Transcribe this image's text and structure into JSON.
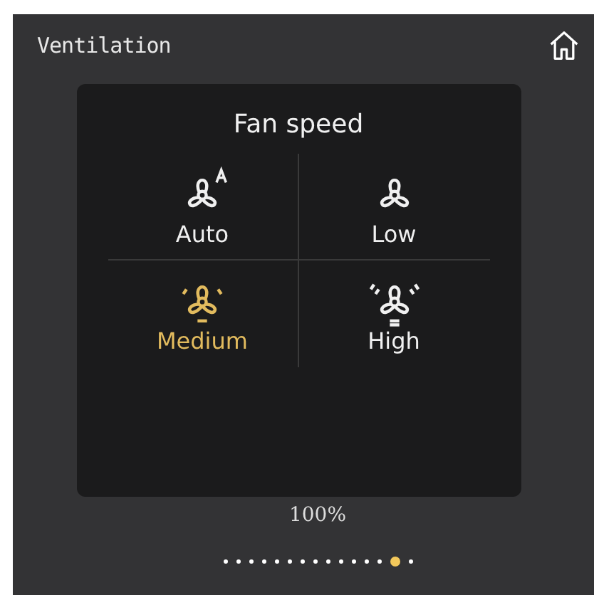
{
  "header": {
    "title": "Ventilation"
  },
  "popup": {
    "title": "Fan speed",
    "options": [
      {
        "kind": "auto",
        "label": "Auto",
        "selected": false
      },
      {
        "kind": "low",
        "label": "Low",
        "selected": false
      },
      {
        "kind": "medium",
        "label": "Medium",
        "selected": true
      },
      {
        "kind": "high",
        "label": "High",
        "selected": false
      }
    ]
  },
  "reading": "100%",
  "pages": [
    {
      "selected": false
    },
    {
      "selected": false
    },
    {
      "selected": false
    },
    {
      "selected": false
    },
    {
      "selected": false
    },
    {
      "selected": false
    },
    {
      "selected": false
    },
    {
      "selected": false
    },
    {
      "selected": false
    },
    {
      "selected": false
    },
    {
      "selected": false
    },
    {
      "selected": false
    },
    {
      "selected": false
    },
    {
      "selected": true
    },
    {
      "selected": false
    }
  ]
}
